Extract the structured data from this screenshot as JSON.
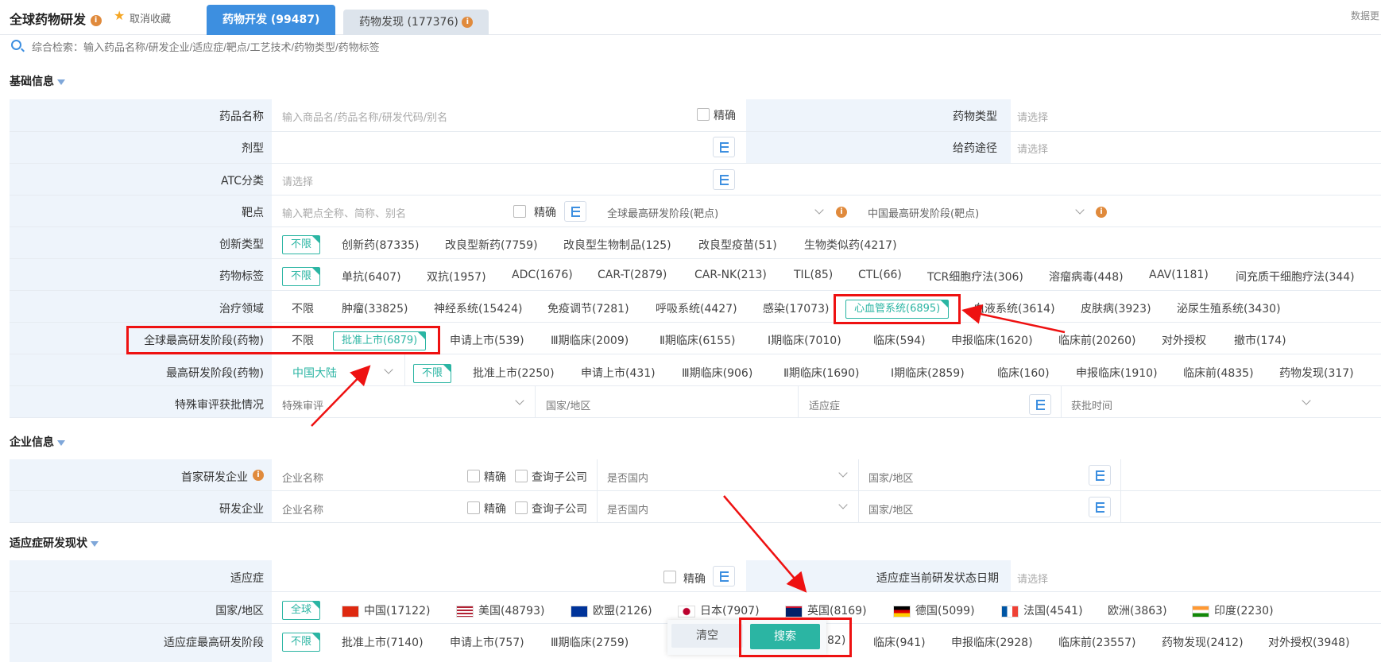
{
  "app": {
    "title": "全球药物研发",
    "fav": "取消收藏",
    "topright": "数据更"
  },
  "tabs": [
    {
      "label": "药物开发 (99487)"
    },
    {
      "label": "药物发现 (177376)"
    }
  ],
  "search": {
    "placeholder": "综合检索：输入药品名称/研发企业/适应症/靶点/工艺技术/药物类型/药物标签"
  },
  "sections": {
    "basic": "基础信息",
    "company": "企业信息",
    "indication": "适应症研发现状"
  },
  "fields": {
    "drug_name": {
      "label": "药品名称",
      "placeholder": "输入商品名/药品名称/研发代码/别名",
      "exact": "精确"
    },
    "drug_type": {
      "label": "药物类型",
      "placeholder": "请选择"
    },
    "dosage": {
      "label": "剂型"
    },
    "route": {
      "label": "给药途径",
      "placeholder": "请选择"
    },
    "atc": {
      "label": "ATC分类",
      "placeholder": "请选择"
    },
    "target": {
      "label": "靶点",
      "placeholder": "输入靶点全称、简称、别名",
      "exact": "精确",
      "global_stage": "全球最高研发阶段(靶点)",
      "china_stage": "中国最高研发阶段(靶点)"
    },
    "innovation": {
      "label": "创新类型",
      "options": [
        "不限",
        "创新药(87335)",
        "改良型新药(7759)",
        "改良型生物制品(125)",
        "改良型疫苗(51)",
        "生物类似药(4217)"
      ]
    },
    "tags": {
      "label": "药物标签",
      "options": [
        "不限",
        "单抗(6407)",
        "双抗(1957)",
        "ADC(1676)",
        "CAR-T(2879)",
        "CAR-NK(213)",
        "TIL(85)",
        "CTL(66)",
        "TCR细胞疗法(306)",
        "溶瘤病毒(448)",
        "AAV(1181)",
        "间充质干细胞疗法(344)"
      ]
    },
    "therapy": {
      "label": "治疗领域",
      "options": [
        "不限",
        "肿瘤(33825)",
        "神经系统(15424)",
        "免疫调节(7281)",
        "呼吸系统(4427)",
        "感染(17073)",
        "心血管系统(6895)",
        "血液系统(3614)",
        "皮肤病(3923)",
        "泌尿生殖系统(3430)"
      ]
    },
    "global_stage": {
      "label": "全球最高研发阶段(药物)",
      "options": [
        "不限",
        "批准上市(6879)",
        "申请上市(539)",
        "Ⅲ期临床(2009)",
        "Ⅱ期临床(6155)",
        "Ⅰ期临床(7010)",
        "临床(594)",
        "申报临床(1620)",
        "临床前(20260)",
        "对外授权",
        "撤市(174)"
      ]
    },
    "region_stage": {
      "label": "最高研发阶段(药物)",
      "region": "中国大陆",
      "options": [
        "不限",
        "批准上市(2250)",
        "申请上市(431)",
        "Ⅲ期临床(906)",
        "Ⅱ期临床(1690)",
        "Ⅰ期临床(2859)",
        "临床(160)",
        "申报临床(1910)",
        "临床前(4835)",
        "药物发现(317)"
      ]
    },
    "special": {
      "label": "特殊审评获批情况",
      "placeholder": "特殊审评",
      "country": "国家/地区",
      "indication": "适应症",
      "time": "获批时间"
    },
    "first_company": {
      "label": "首家研发企业",
      "placeholder": "企业名称",
      "exact": "精确",
      "sub": "查询子公司",
      "domestic": "是否国内",
      "country": "国家/地区"
    },
    "company": {
      "label": "研发企业",
      "placeholder": "企业名称",
      "exact": "精确",
      "sub": "查询子公司",
      "domestic": "是否国内",
      "country": "国家/地区"
    },
    "ind": {
      "label": "适应症",
      "exact": "精确",
      "date_label": "适应症当前研发状态日期",
      "date_placeholder": "请选择"
    },
    "ind_country": {
      "label": "国家/地区",
      "options": [
        "全球",
        "中国(17122)",
        "美国(48793)",
        "欧盟(2126)",
        "日本(7907)",
        "英国(8169)",
        "德国(5099)",
        "法国(4541)",
        "欧洲(3863)",
        "印度(2230)"
      ]
    },
    "ind_stage": {
      "label": "适应症最高研发阶段",
      "options": [
        "不限",
        "批准上市(7140)",
        "申请上市(757)",
        "Ⅲ期临床(2759)",
        "82)",
        "临床(941)",
        "申报临床(2928)",
        "临床前(23557)",
        "药物发现(2412)",
        "对外授权(3948)"
      ]
    }
  },
  "buttons": {
    "clear": "清空",
    "search": "搜索"
  }
}
